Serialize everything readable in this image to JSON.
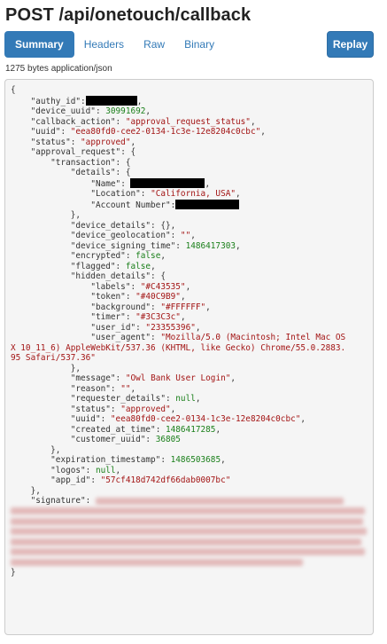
{
  "page": {
    "title": "POST /api/onetouch/callback",
    "meta": "1275 bytes application/json"
  },
  "tabs": [
    {
      "label": "Summary",
      "active": true
    },
    {
      "label": "Headers",
      "active": false
    },
    {
      "label": "Raw",
      "active": false
    },
    {
      "label": "Binary",
      "active": false
    }
  ],
  "replay_label": "Replay",
  "colors": {
    "accent": "#337ab7",
    "string": "#a31515",
    "number": "#1a7f1a",
    "code_bg": "#f5f5f5"
  },
  "json_body": {
    "open": "{",
    "close": "}",
    "authy_id_key": "\"authy_id\"",
    "device_uuid_key": "\"device_uuid\"",
    "device_uuid_val": "30991692",
    "callback_action_key": "\"callback_action\"",
    "callback_action_val": "\"approval_request_status\"",
    "uuid_key": "\"uuid\"",
    "uuid_val": "\"eea80fd0-cee2-0134-1c3e-12e8204c0cbc\"",
    "status_key": "\"status\"",
    "status_val": "\"approved\"",
    "approval_request_key": "\"approval_request\"",
    "transaction_key": "\"transaction\"",
    "details_key": "\"details\"",
    "name_key": "\"Name\"",
    "location_key": "\"Location\"",
    "location_val": "\"California, USA\"",
    "account_key": "\"Account Number\"",
    "device_details_key": "\"device_details\"",
    "device_details_val": "{}",
    "device_geolocation_key": "\"device_geolocation\"",
    "device_geolocation_val": "\"\"",
    "device_signing_time_key": "\"device_signing_time\"",
    "device_signing_time_val": "1486417303",
    "encrypted_key": "\"encrypted\"",
    "encrypted_val": "false",
    "flagged_key": "\"flagged\"",
    "flagged_val": "false",
    "hidden_details_key": "\"hidden_details\"",
    "labels_key": "\"labels\"",
    "labels_val": "\"#C43535\"",
    "token_key": "\"token\"",
    "token_val": "\"#40C9B9\"",
    "background_key": "\"background\"",
    "background_val": "\"#FFFFFF\"",
    "timer_key": "\"timer\"",
    "timer_val": "\"#3C3C3c\"",
    "user_id_key": "\"user_id\"",
    "user_id_val": "\"23355396\"",
    "user_agent_key": "\"user_agent\"",
    "user_agent_val_1": "\"Mozilla/5.0 (Macintosh; Intel Mac OS",
    "user_agent_val_2": "X 10_11_6) AppleWebKit/537.36 (KHTML, like Gecko) Chrome/55.0.2883.",
    "user_agent_val_3": "95 Safari/537.36\"",
    "message_key": "\"message\"",
    "message_val": "\"Owl Bank User Login\"",
    "reason_key": "\"reason\"",
    "reason_val": "\"\"",
    "requester_details_key": "\"requester_details\"",
    "requester_details_val": "null",
    "status2_key": "\"status\"",
    "status2_val": "\"approved\"",
    "uuid2_key": "\"uuid\"",
    "uuid2_val": "\"eea80fd0-cee2-0134-1c3e-12e8204c0cbc\"",
    "created_at_time_key": "\"created_at_time\"",
    "created_at_time_val": "1486417285",
    "customer_uuid_key": "\"customer_uuid\"",
    "customer_uuid_val": "36805",
    "expiration_timestamp_key": "\"expiration_timestamp\"",
    "expiration_timestamp_val": "1486503685",
    "logos_key": "\"logos\"",
    "logos_val": "null",
    "app_id_key": "\"app_id\"",
    "app_id_val": "\"57cf418d742df66dab0007bc\"",
    "signature_key": "\"signature\""
  }
}
